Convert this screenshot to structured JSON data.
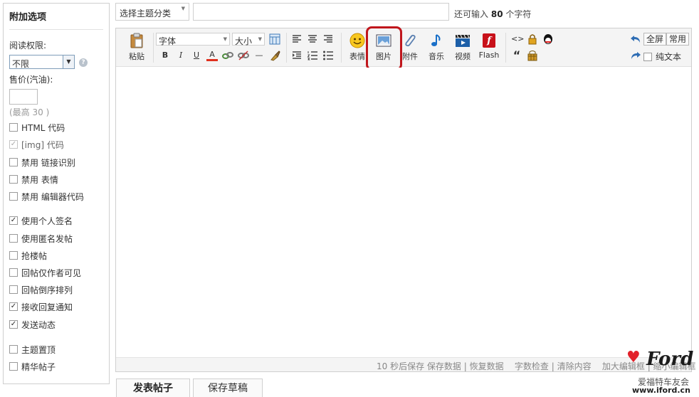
{
  "sidebar": {
    "title": "附加选项",
    "read_perm_label": "阅读权限:",
    "read_perm_value": "不限",
    "help_icon": "?",
    "price_label": "售价(汽油):",
    "price_value": "",
    "price_hint": "(最高 30 )",
    "options": [
      {
        "label": "HTML 代码",
        "checked": false,
        "disabled": false
      },
      {
        "label": "[img] 代码",
        "checked": true,
        "disabled": true
      },
      {
        "label": "禁用 链接识别",
        "checked": false,
        "disabled": false
      },
      {
        "label": "禁用 表情",
        "checked": false,
        "disabled": false
      },
      {
        "label": "禁用 编辑器代码",
        "checked": false,
        "disabled": false
      },
      {
        "label": "使用个人签名",
        "checked": true,
        "disabled": false
      },
      {
        "label": "使用匿名发帖",
        "checked": false,
        "disabled": false
      },
      {
        "label": "抢楼帖",
        "checked": false,
        "disabled": false
      },
      {
        "label": "回帖仅作者可见",
        "checked": false,
        "disabled": false
      },
      {
        "label": "回帖倒序排列",
        "checked": false,
        "disabled": false
      },
      {
        "label": "接收回复通知",
        "checked": true,
        "disabled": false
      },
      {
        "label": "发送动态",
        "checked": true,
        "disabled": false
      },
      {
        "label": "主题置顶",
        "checked": false,
        "disabled": false
      },
      {
        "label": "精华帖子",
        "checked": false,
        "disabled": false
      }
    ]
  },
  "topbar": {
    "category_value": "选择主题分类",
    "subject_value": "",
    "remaining_prefix": "还可输入",
    "remaining_count": "80",
    "remaining_suffix": "个字符"
  },
  "toolbar": {
    "paste_label": "粘贴",
    "font_value": "字体",
    "size_value": "大小",
    "emoji_label": "表情",
    "image_label": "图片",
    "attach_label": "附件",
    "music_label": "音乐",
    "video_label": "视频",
    "flash_label": "Flash",
    "bold": "B",
    "italic": "I",
    "underline": "U",
    "fontcolor": "A",
    "hr": "—",
    "code": "<>",
    "quote": "“",
    "fullscreen_label": "全屏",
    "common_label": "常用",
    "plaintext_label": "纯文本"
  },
  "statusbar": {
    "autosave": "10 秒后保存",
    "save_data": "保存数据",
    "restore_data": "恢复数据",
    "word_check": "字数检查",
    "clear_content": "清除内容",
    "enlarge": "加大编辑框",
    "shrink": "缩小编辑框"
  },
  "buttons": {
    "publish": "发表帖子",
    "save_draft": "保存草稿"
  },
  "watermark": {
    "brand": "Ford",
    "club": "爱福特车友会",
    "url": "www.iford.cn"
  },
  "colors": {
    "highlight": "#c0161c",
    "panel_border": "#cfcfcf",
    "toolbar_bg": "#f4f4f4",
    "heart": "#e2212a"
  }
}
